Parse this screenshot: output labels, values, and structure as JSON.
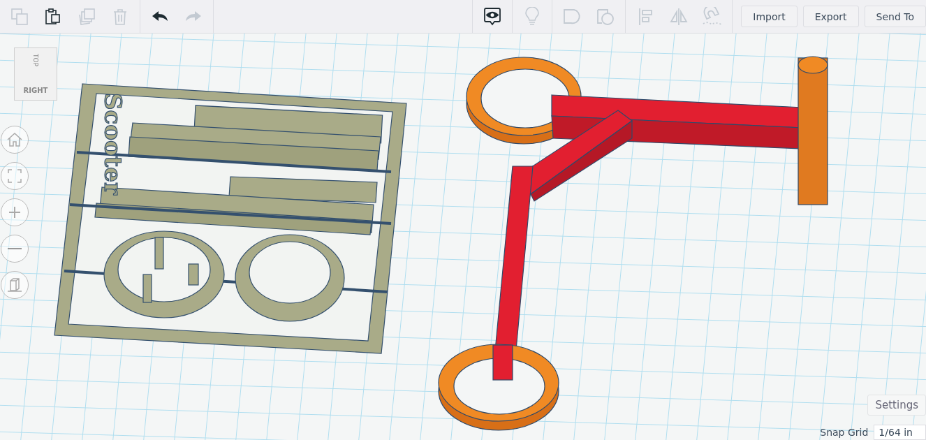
{
  "toolbar": {
    "edit_tools": [
      {
        "kind": "copy",
        "disabled": true
      },
      {
        "kind": "paste",
        "disabled": false
      },
      {
        "kind": "duplicate",
        "disabled": true
      },
      {
        "kind": "delete",
        "disabled": true
      }
    ],
    "history": [
      {
        "kind": "undo",
        "disabled": false
      },
      {
        "kind": "redo",
        "disabled": true
      }
    ],
    "view_groups": [
      {
        "tools": [
          {
            "kind": "note",
            "disabled": false
          }
        ]
      },
      {
        "tools": [
          {
            "kind": "light",
            "disabled": true
          }
        ]
      },
      {
        "tools": [
          {
            "kind": "group",
            "disabled": true
          },
          {
            "kind": "ungroup",
            "disabled": true
          }
        ]
      },
      {
        "tools": [
          {
            "kind": "align",
            "disabled": true
          },
          {
            "kind": "mirror",
            "disabled": true
          },
          {
            "kind": "magnet",
            "disabled": true
          }
        ]
      }
    ],
    "buttons": [
      "Import",
      "Export",
      "Send To"
    ]
  },
  "view_cube": {
    "top": "TOP",
    "right": "RIGHT"
  },
  "view_controls": [
    {
      "kind": "home"
    },
    {
      "kind": "fit"
    },
    {
      "kind": "zoom_in"
    },
    {
      "kind": "zoom_out"
    },
    {
      "kind": "perspective"
    }
  ],
  "scene": {
    "model_text": "Scooter"
  },
  "settings_button": "Settings",
  "snap_grid": {
    "label": "Snap Grid",
    "value": "1/64 in"
  }
}
